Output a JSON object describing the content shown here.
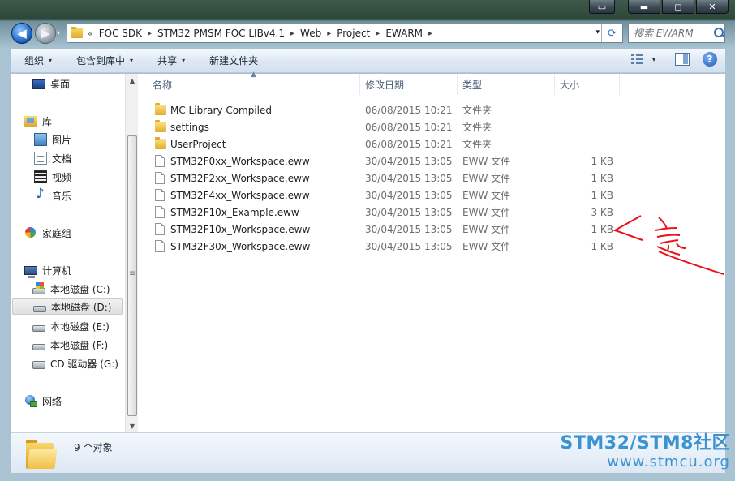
{
  "window": {
    "caption_buttons": {
      "snap": "▭",
      "minimize": "▬",
      "maximize": "◻",
      "close": "✕"
    }
  },
  "navigation": {
    "back_glyph": "◀",
    "forward_glyph": "▶",
    "history_glyph": "▾",
    "crumb_lead": "«",
    "breadcrumbs": [
      "FOC SDK",
      "STM32 PMSM FOC LIBv4.1",
      "Web",
      "Project",
      "EWARM"
    ],
    "crumb_separator": "▸",
    "dropdown_glyph": "▾",
    "refresh_glyph": "⟳"
  },
  "search": {
    "placeholder": "搜索 EWARM"
  },
  "toolbar": {
    "organize": "组织",
    "include_in_library": "包含到库中",
    "share": "共享",
    "new_folder": "新建文件夹",
    "caret": "▾",
    "help": "?"
  },
  "sidebar": {
    "desktop": "桌面",
    "libraries": "库",
    "pictures": "图片",
    "documents": "文档",
    "videos": "视频",
    "music": "音乐",
    "homegroup": "家庭组",
    "computer": "计算机",
    "drive_c": "本地磁盘 (C:)",
    "drive_d": "本地磁盘 (D:)",
    "drive_e": "本地磁盘 (E:)",
    "drive_f": "本地磁盘 (F:)",
    "drive_g": "CD 驱动器 (G:)",
    "network": "网络",
    "selected": "drive_d"
  },
  "scrollbar": {
    "up": "▲",
    "down": "▼"
  },
  "columns": {
    "name": "名称",
    "date": "修改日期",
    "type": "类型",
    "size": "大小",
    "sort_glyph": "▲"
  },
  "files": [
    {
      "kind": "folder",
      "name": "MC Library Compiled",
      "date": "06/08/2015 10:21",
      "type": "文件夹",
      "size": ""
    },
    {
      "kind": "folder",
      "name": "settings",
      "date": "06/08/2015 10:21",
      "type": "文件夹",
      "size": ""
    },
    {
      "kind": "folder",
      "name": "UserProject",
      "date": "06/08/2015 10:21",
      "type": "文件夹",
      "size": ""
    },
    {
      "kind": "file",
      "name": "STM32F0xx_Workspace.eww",
      "date": "30/04/2015 13:05",
      "type": "EWW 文件",
      "size": "1 KB"
    },
    {
      "kind": "file",
      "name": "STM32F2xx_Workspace.eww",
      "date": "30/04/2015 13:05",
      "type": "EWW 文件",
      "size": "1 KB"
    },
    {
      "kind": "file",
      "name": "STM32F4xx_Workspace.eww",
      "date": "30/04/2015 13:05",
      "type": "EWW 文件",
      "size": "1 KB"
    },
    {
      "kind": "file",
      "name": "STM32F10x_Example.eww",
      "date": "30/04/2015 13:05",
      "type": "EWW 文件",
      "size": "3 KB"
    },
    {
      "kind": "file",
      "name": "STM32F10x_Workspace.eww",
      "date": "30/04/2015 13:05",
      "type": "EWW 文件",
      "size": "1 KB"
    },
    {
      "kind": "file",
      "name": "STM32F30x_Workspace.eww",
      "date": "30/04/2015 13:05",
      "type": "EWW 文件",
      "size": "1 KB"
    }
  ],
  "details": {
    "item_count": "9 个对象"
  },
  "watermark": {
    "title": "STM32/STM8社区",
    "url": "www.stmcu.org",
    "color": "#3b93d2"
  },
  "annotation": {
    "color": "#e8101a"
  }
}
